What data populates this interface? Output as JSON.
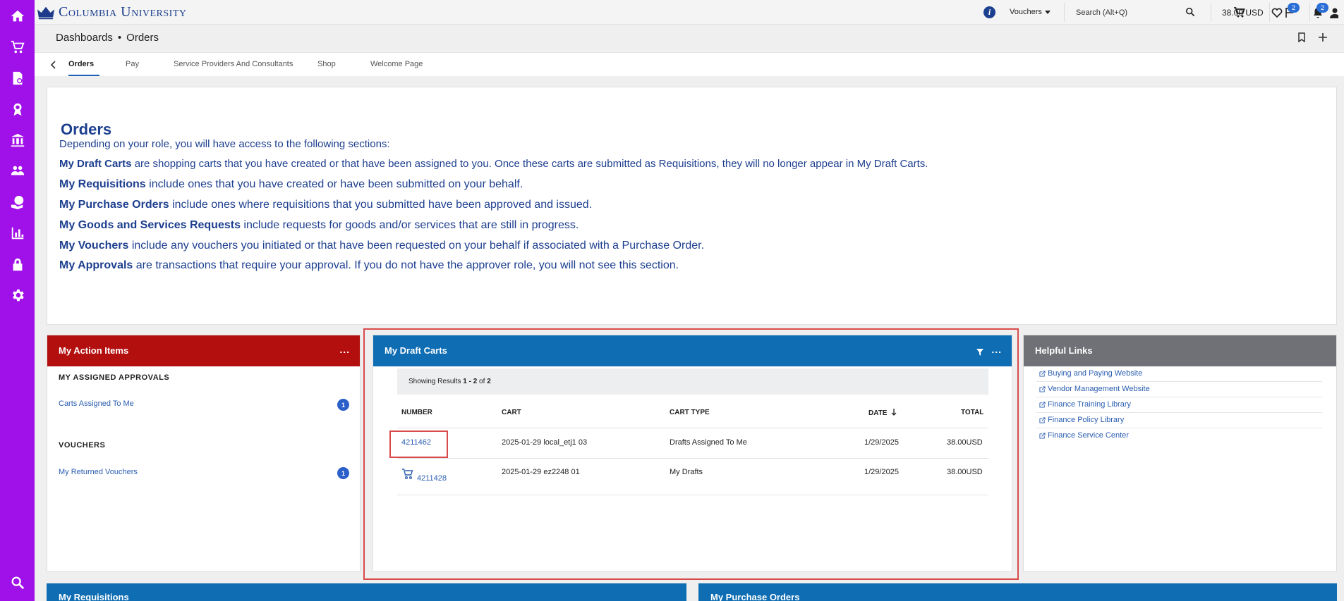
{
  "sidebar": {
    "icons": [
      "home-icon",
      "cart-icon",
      "document-icon",
      "ribbon-icon",
      "bank-icon",
      "people-icon",
      "globe-hand-icon",
      "bar-chart-icon",
      "lock-icon",
      "gear-icon",
      "search-icon"
    ]
  },
  "header": {
    "brand": "Columbia University",
    "vouchers_label": "Vouchers",
    "search_placeholder": "Search (Alt+Q)",
    "cart_total": "38.00 USD",
    "flag_badge": "2",
    "bell_badge": "2"
  },
  "breadcrumb": {
    "root": "Dashboards",
    "separator": "•",
    "current": "Orders"
  },
  "tabs": [
    "Orders",
    "Pay",
    "Service Providers And Consultants",
    "Shop",
    "Welcome Page"
  ],
  "orders_intro": {
    "title": "Orders",
    "intro": "Depending on your role, you will have access to the following sections:",
    "sections": [
      {
        "term": "My Draft Carts",
        "text": " are shopping carts that you have created or that have been assigned to you. Once these carts are submitted as Requisitions, they will no longer appear in My Draft Carts."
      },
      {
        "term": "My Requisitions",
        "text": " include ones that you have created or have been submitted on your behalf."
      },
      {
        "term": "My Purchase Orders",
        "text": " include ones where requisitions that you submitted have been approved and issued."
      },
      {
        "term": "My Goods and Services Requests",
        "text": " include requests for goods and/or services that are still in progress."
      },
      {
        "term": "My Vouchers",
        "text": " include any vouchers you initiated or that have been requested on your behalf if associated with a Purchase Order."
      },
      {
        "term": "My Approvals",
        "text": " are transactions that require your approval. If you do not have the approver role, you will not see this section."
      }
    ]
  },
  "action_items": {
    "title": "My Action Items",
    "menu": "...",
    "approvals_title": "MY ASSIGNED APPROVALS",
    "carts_assigned_link": "Carts Assigned To Me",
    "carts_assigned_count": "1",
    "vouchers_title": "VOUCHERS",
    "returned_vouchers_link": "My Returned Vouchers",
    "returned_vouchers_count": "1"
  },
  "draft_carts": {
    "title": "My Draft Carts",
    "menu": "...",
    "results_prefix": "Showing Results ",
    "results_range": "1 - 2",
    "results_of": " of ",
    "results_total": "2",
    "columns": [
      "NUMBER",
      "CART",
      "CART TYPE",
      "DATE",
      "TOTAL"
    ],
    "rows": [
      {
        "number": "4211462",
        "cart": "2025-01-29 local_etj1 03",
        "type": "Drafts Assigned To Me",
        "date": "1/29/2025",
        "total": "38.00",
        "currency": "USD"
      },
      {
        "number": "4211428",
        "cart": "2025-01-29 ez2248 01",
        "type": "My Drafts",
        "date": "1/29/2025",
        "total": "38.00",
        "currency": "USD"
      }
    ]
  },
  "helpful_links": {
    "title": "Helpful Links",
    "links": [
      "Buying and Paying Website",
      "Vendor Management Website",
      "Finance Training Library",
      "Finance Policy Library",
      "Finance Service Center"
    ]
  },
  "bottom_cards": {
    "left": "My Requisitions",
    "right": "My Purchase Orders"
  },
  "colors": {
    "sidebar": "#a010e8",
    "action_header": "#b30f0f",
    "draft_header": "#0e6db3",
    "help_header": "#6f7176",
    "link": "#2a5db0",
    "highlight": "#d94b4b"
  }
}
